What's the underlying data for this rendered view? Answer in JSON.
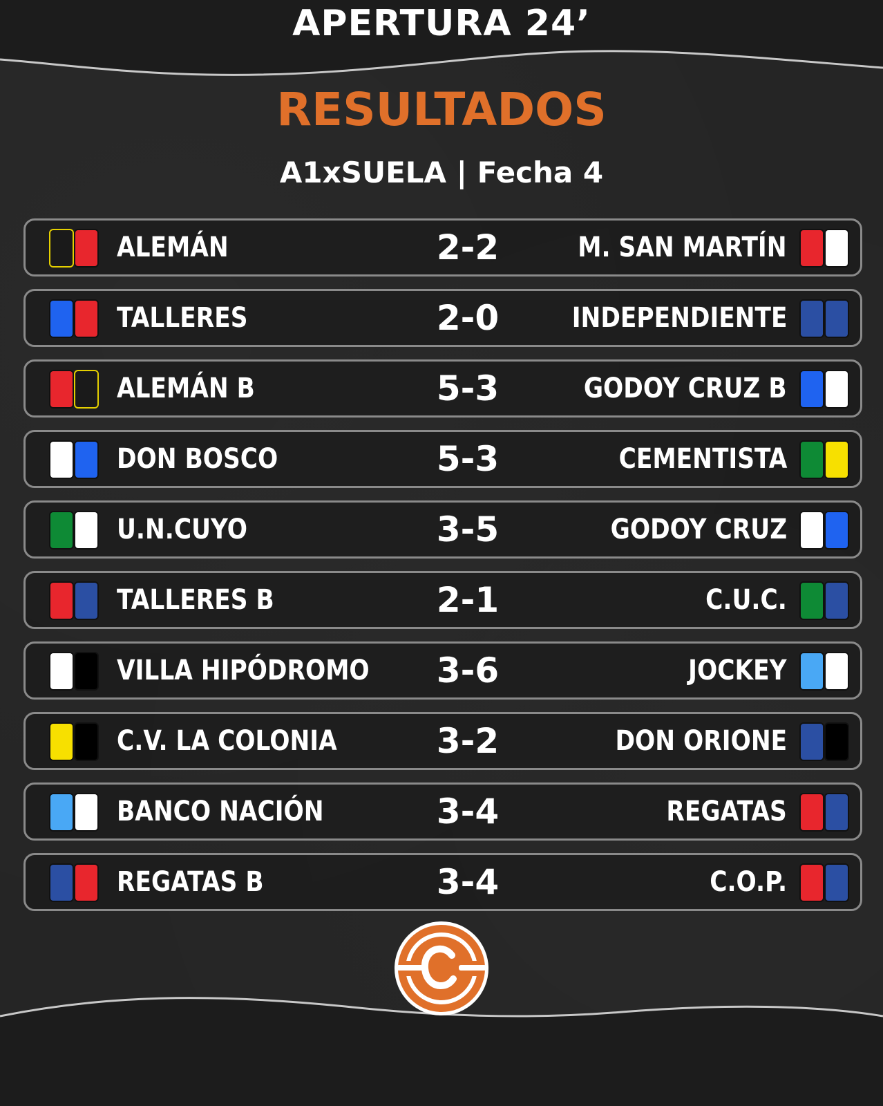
{
  "header": {
    "title": "APERTURA 24’"
  },
  "section": {
    "title": "RESULTADOS"
  },
  "subtitle": "A1xSUELA | Fecha 4",
  "colors": {
    "background": "#252525",
    "accent": "#e0702a",
    "text": "#ffffff",
    "card_border": "#8a8a8a"
  },
  "matches": [
    {
      "home": "ALEMÁN",
      "score": "2-2",
      "away": "M. SAN MARTÍN",
      "home_colors": [
        "#1a1a1a",
        "#e8262d"
      ],
      "home_borders": [
        "#e5d000",
        "#111"
      ],
      "away_colors": [
        "#e8262d",
        "#ffffff"
      ]
    },
    {
      "home": "TALLERES",
      "score": "2-0",
      "away": "INDEPENDIENTE",
      "home_colors": [
        "#1f63f0",
        "#e8262d"
      ],
      "away_colors": [
        "#2b4fa3",
        "#2b4fa3"
      ]
    },
    {
      "home": "ALEMÁN B",
      "score": "5-3",
      "away": "GODOY CRUZ B",
      "home_colors": [
        "#e8262d",
        "#1a1a1a"
      ],
      "home_borders": [
        "#111",
        "#e5d000"
      ],
      "away_colors": [
        "#1f63f0",
        "#ffffff"
      ]
    },
    {
      "home": "DON BOSCO",
      "score": "5-3",
      "away": "CEMENTISTA",
      "home_colors": [
        "#ffffff",
        "#1f63f0"
      ],
      "away_colors": [
        "#0e8a35",
        "#f7e000"
      ]
    },
    {
      "home": "U.N.CUYO",
      "score": "3-5",
      "away": "GODOY CRUZ",
      "home_colors": [
        "#0e8a35",
        "#ffffff"
      ],
      "away_colors": [
        "#ffffff",
        "#1f63f0"
      ]
    },
    {
      "home": "TALLERES B",
      "score": "2-1",
      "away": "C.U.C.",
      "home_colors": [
        "#e8262d",
        "#2b4fa3"
      ],
      "away_colors": [
        "#0e8a35",
        "#2b4fa3"
      ]
    },
    {
      "home": "VILLA HIPÓDROMO",
      "score": "3-6",
      "away": "JOCKEY",
      "home_colors": [
        "#ffffff",
        "#000000"
      ],
      "away_colors": [
        "#49a8f5",
        "#ffffff"
      ]
    },
    {
      "home": "C.V. LA COLONIA",
      "score": "3-2",
      "away": "DON ORIONE",
      "home_colors": [
        "#f7e000",
        "#000000"
      ],
      "away_colors": [
        "#2b4fa3",
        "#000000"
      ]
    },
    {
      "home": "BANCO NACIÓN",
      "score": "3-4",
      "away": "REGATAS",
      "home_colors": [
        "#49a8f5",
        "#ffffff"
      ],
      "away_colors": [
        "#e8262d",
        "#2b4fa3"
      ]
    },
    {
      "home": "REGATAS B",
      "score": "3-4",
      "away": "C.O.P.",
      "home_colors": [
        "#2b4fa3",
        "#e8262d"
      ],
      "away_colors": [
        "#e8262d",
        "#2b4fa3"
      ]
    }
  ],
  "logo": {
    "icon": "brand-c-logo-icon",
    "color": "#e0702a"
  }
}
